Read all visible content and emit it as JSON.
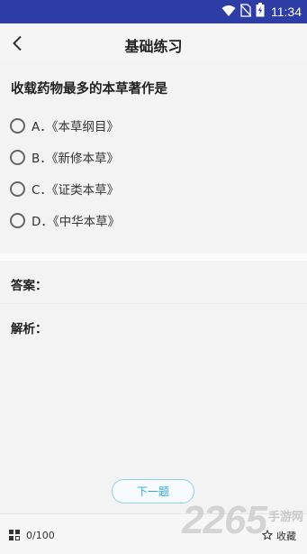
{
  "status": {
    "time": "11:34"
  },
  "header": {
    "title": "基础练习"
  },
  "question": {
    "text": "收载药物最多的本草著作是",
    "options": [
      {
        "label": "A．《本草纲目》"
      },
      {
        "label": "B．《新修本草》"
      },
      {
        "label": "C．《证类本草》"
      },
      {
        "label": "D．《中华本草》"
      }
    ]
  },
  "answer": {
    "label": "答案："
  },
  "analysis": {
    "label": "解析："
  },
  "next_button": {
    "label": "下一题"
  },
  "footer": {
    "progress": "0/100",
    "favorite_label": "收藏"
  },
  "watermark": {
    "number": "2265",
    "text": "手游网"
  },
  "colors": {
    "status_bar": "#2e3ca5",
    "accent": "#2aa8dc"
  }
}
